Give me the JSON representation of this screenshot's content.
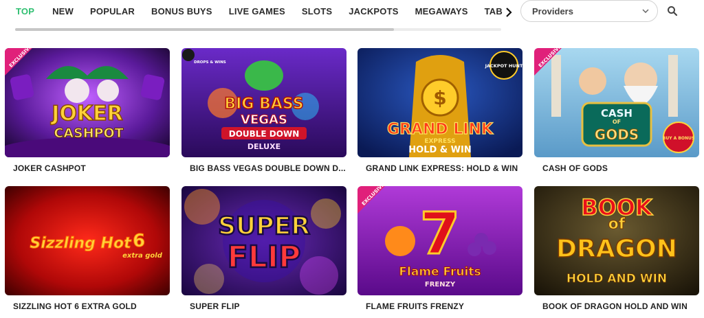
{
  "nav": {
    "tabs": [
      {
        "label": "TOP",
        "active": true
      },
      {
        "label": "NEW"
      },
      {
        "label": "POPULAR"
      },
      {
        "label": "BONUS BUYS"
      },
      {
        "label": "LIVE GAMES"
      },
      {
        "label": "SLOTS"
      },
      {
        "label": "JACKPOTS"
      },
      {
        "label": "MEGAWAYS"
      },
      {
        "label": "TABLE GAM"
      }
    ],
    "scroll_icon": "chevron-right-icon",
    "scroll_position": 0.78
  },
  "providers": {
    "label": "Providers",
    "icon": "chevron-down-icon"
  },
  "search": {
    "icon": "search-icon"
  },
  "colors": {
    "accent": "#2fbf71",
    "exclusive": "#e0207a"
  },
  "games": [
    {
      "title": "JOKER CASHPOT",
      "badge": "EXCLUSIVE",
      "art": [
        "JOKER",
        "CASHPOT"
      ]
    },
    {
      "title": "BIG BASS VEGAS DOUBLE DOWN D...",
      "badge": "DROPS & WINS",
      "art": [
        "BIG BASS",
        "VEGAS",
        "DOUBLE DOWN",
        "DELUXE"
      ]
    },
    {
      "title": "GRAND LINK EXPRESS: HOLD & WIN",
      "badge": "JACKPOT HUNT",
      "art": [
        "GRAND LINK",
        "EXPRESS",
        "HOLD & WIN"
      ]
    },
    {
      "title": "CASH OF GODS",
      "badge": "EXCLUSIVE",
      "art": [
        "CASH",
        "OF",
        "GODS",
        "BUY A BONUS"
      ]
    },
    {
      "title": "SIZZLING HOT 6 EXTRA GOLD",
      "art": [
        "Sizzling Hot",
        "6",
        "extra gold"
      ]
    },
    {
      "title": "SUPER FLIP",
      "art": [
        "SUPER",
        "FLIP"
      ]
    },
    {
      "title": "FLAME FRUITS FRENZY",
      "badge": "EXCLUSIVE",
      "art": [
        "7",
        "Flame Fruits",
        "FRENZY"
      ]
    },
    {
      "title": "BOOK OF DRAGON HOLD AND WIN",
      "art": [
        "BOOK",
        "of",
        "DRAGON",
        "HOLD AND WIN"
      ]
    }
  ]
}
